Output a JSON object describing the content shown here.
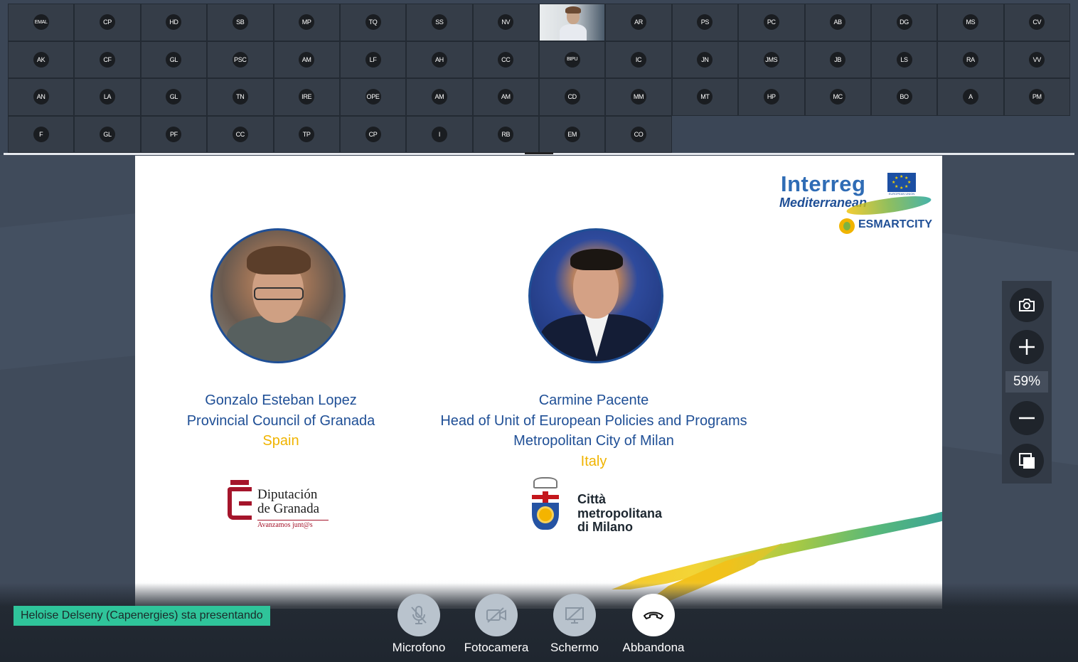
{
  "participants": {
    "rows": [
      [
        "EMAL",
        "CP",
        "HD",
        "SB",
        "MP",
        "TQ",
        "SS",
        "NV",
        "",
        "AR",
        "PS",
        "PC",
        "AB",
        "DG",
        "MS",
        "CV"
      ],
      [
        "AK",
        "CF",
        "GL",
        "PSC",
        "AM",
        "LF",
        "AH",
        "CC",
        "BIPU",
        "IC",
        "JN",
        "JMS",
        "JB",
        "LS",
        "RA",
        "VV"
      ],
      [
        "AN",
        "LA",
        "GL",
        "TN",
        "IRE",
        "OPE",
        "AM",
        "AM",
        "CD",
        "MM",
        "MT",
        "HP",
        "MC",
        "BO",
        "A",
        "PM"
      ],
      [
        "F",
        "GL",
        "PF",
        "CC",
        "TP",
        "CP",
        "I",
        "RB",
        "EM",
        "CO"
      ]
    ],
    "video_tile_index": [
      0,
      8
    ]
  },
  "slide": {
    "logo": {
      "interreg": "Interreg",
      "mediterranean": "Mediterranean",
      "eu_caption": "EUROPEAN UNION",
      "esmartcity": "ESMARTCITY"
    },
    "left": {
      "name": "Gonzalo Esteban Lopez",
      "org": "Provincial Council of Granada",
      "country": "Spain",
      "logo_name_1": "Diputación",
      "logo_name_2": "de Granada",
      "logo_tagline": "Avanzamos junt@s"
    },
    "right": {
      "name": "Carmine Pacente",
      "role": "Head of Unit of European Policies and Programs",
      "org": "Metropolitan City of Milan",
      "country": "Italy",
      "logo_line_1": "Città",
      "logo_line_2": "metropolitana",
      "logo_line_3": "di Milano"
    }
  },
  "zoom": {
    "level": "59%",
    "icons": [
      "camera-icon",
      "plus-icon",
      "minus-icon",
      "copy-icon"
    ]
  },
  "presenter_text": "Heloise Delseny (Capenergies) sta presentando",
  "controls": {
    "mic": "Microfono",
    "camera": "Fotocamera",
    "screen": "Schermo",
    "leave": "Abbandona"
  },
  "colors": {
    "slide_blue": "#1f4f96",
    "slide_yellow": "#f0b400",
    "presenter_badge": "#2fc49a",
    "app_background": "#3b4656"
  }
}
